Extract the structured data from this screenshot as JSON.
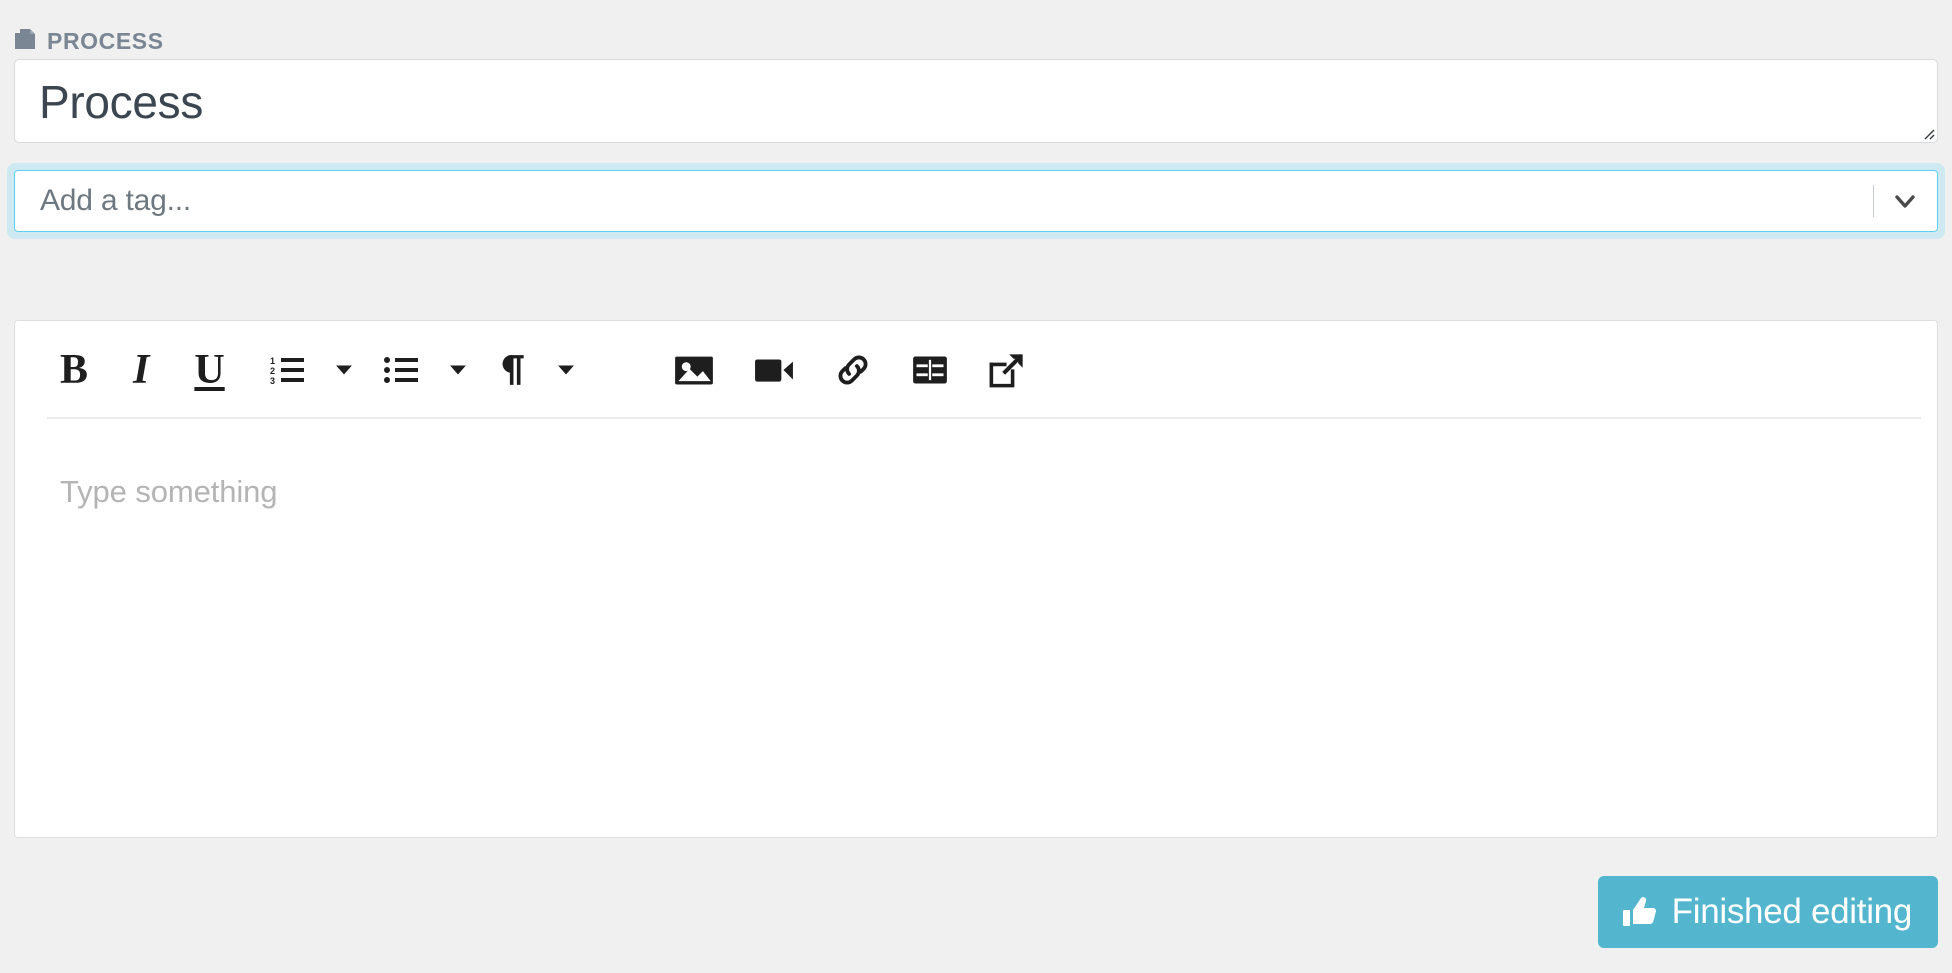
{
  "header": {
    "icon": "copy-pages-icon",
    "title": "PROCESS"
  },
  "title_field": {
    "value": "Process",
    "resize_grip": "resize-grip-icon"
  },
  "tag_field": {
    "placeholder": "Add a tag...",
    "value": "",
    "caret_icon": "chevron-down-icon",
    "focused": true,
    "focus_ring_color": "#cfe9f2",
    "border_color": "#5fd0ef"
  },
  "editor": {
    "placeholder": "Type something",
    "toolbar": [
      {
        "name": "bold-button",
        "label": "B",
        "icon": "bold-icon"
      },
      {
        "name": "italic-button",
        "label": "I",
        "icon": "italic-icon"
      },
      {
        "name": "underline-button",
        "label": "U",
        "icon": "underline-icon"
      },
      {
        "name": "ordered-list-button",
        "label": "",
        "icon": "ordered-list-icon"
      },
      {
        "name": "ordered-list-dropdown",
        "label": "",
        "icon": "caret-down-icon"
      },
      {
        "name": "unordered-list-button",
        "label": "",
        "icon": "unordered-list-icon"
      },
      {
        "name": "unordered-list-dropdown",
        "label": "",
        "icon": "caret-down-icon"
      },
      {
        "name": "paragraph-format-button",
        "label": "",
        "icon": "pilcrow-icon"
      },
      {
        "name": "paragraph-format-dropdown",
        "label": "",
        "icon": "caret-down-icon"
      },
      {
        "name": "insert-image-button",
        "label": "",
        "icon": "image-icon"
      },
      {
        "name": "insert-video-button",
        "label": "",
        "icon": "video-camera-icon"
      },
      {
        "name": "insert-link-button",
        "label": "",
        "icon": "link-icon"
      },
      {
        "name": "insert-table-button",
        "label": "",
        "icon": "table-icon"
      },
      {
        "name": "fullscreen-button",
        "label": "",
        "icon": "external-link-icon"
      }
    ]
  },
  "footer": {
    "finish_label": "Finished editing",
    "finish_icon": "thumbs-up-icon",
    "finish_color": "#53b6ce"
  },
  "colors": {
    "page_background": "#f0f0f0",
    "panel_background": "#ffffff",
    "panel_border": "#dcdfe2",
    "header_text": "#7a8693",
    "title_text": "#3c4650",
    "placeholder_text": "#b4b4b4"
  }
}
